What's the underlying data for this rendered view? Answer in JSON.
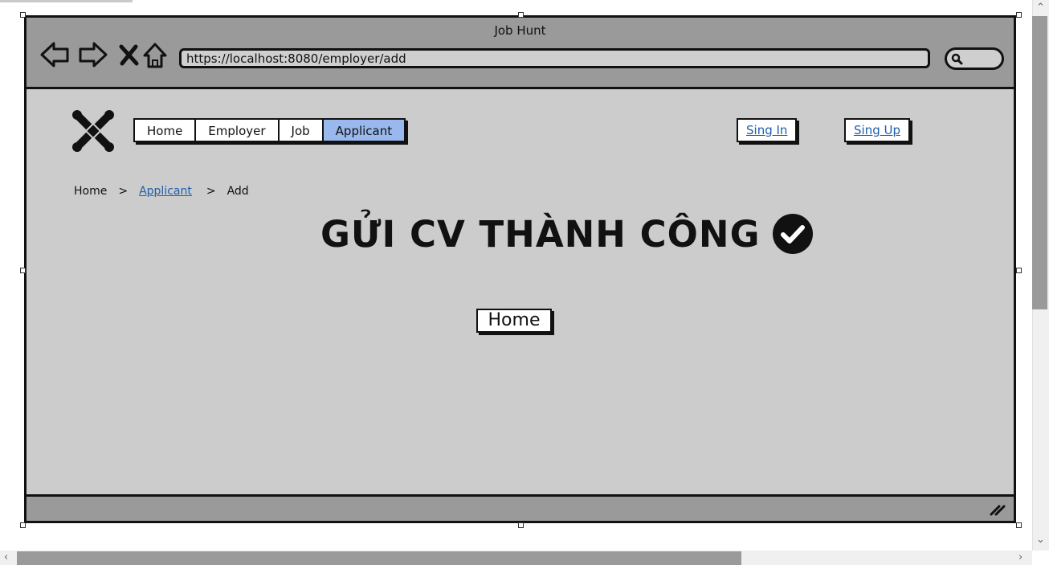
{
  "window": {
    "title": "Job Hunt"
  },
  "toolbar": {
    "url": "https://localhost:8080/employer/add",
    "icons": [
      "back-arrow-icon",
      "forward-arrow-icon",
      "close-x-icon",
      "home-icon",
      "search-icon"
    ]
  },
  "nav": {
    "menu": [
      {
        "label": "Home",
        "active": false
      },
      {
        "label": "Employer",
        "active": false
      },
      {
        "label": "Job",
        "active": false
      },
      {
        "label": "Applicant",
        "active": true
      }
    ],
    "signin_label": "Sing In",
    "signup_label": "Sing Up"
  },
  "breadcrumb": {
    "items": [
      "Home",
      "Applicant",
      "Add"
    ],
    "separator": ">"
  },
  "main": {
    "headline": "GỬI CV THÀNH CÔNG",
    "home_button_label": "Home"
  },
  "colors": {
    "titlebar": "#9a9a9a",
    "content_bg": "#cccccc",
    "active_menu": "#99b8ee",
    "link": "#1f5eaa"
  }
}
